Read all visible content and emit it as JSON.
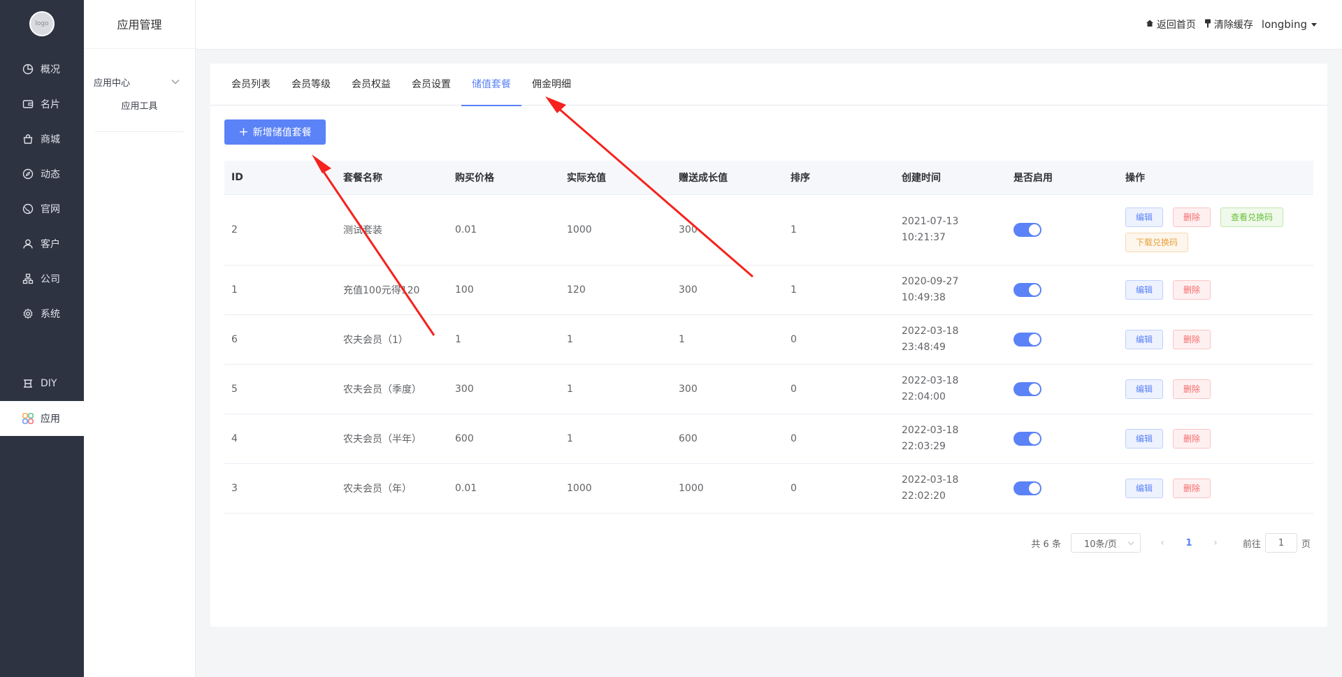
{
  "nav": {
    "logo_text": "logo",
    "items": [
      {
        "label": "概况"
      },
      {
        "label": "名片"
      },
      {
        "label": "商城"
      },
      {
        "label": "动态"
      },
      {
        "label": "官网"
      },
      {
        "label": "客户"
      },
      {
        "label": "公司"
      },
      {
        "label": "系统"
      },
      {
        "label": "DIY"
      },
      {
        "label": "应用"
      }
    ]
  },
  "submenu": {
    "title": "应用管理",
    "group_label": "应用中心",
    "item_label": "应用工具"
  },
  "header": {
    "home": "返回首页",
    "clear_cache": "清除缓存",
    "user": "longbing"
  },
  "tabs": [
    "会员列表",
    "会员等级",
    "会员权益",
    "会员设置",
    "储值套餐",
    "佣金明细"
  ],
  "active_tab": 4,
  "add_button": "新增储值套餐",
  "table": {
    "columns": [
      "ID",
      "套餐名称",
      "购买价格",
      "实际充值",
      "赠送成长值",
      "排序",
      "创建时间",
      "是否启用",
      "操作"
    ],
    "rows": [
      {
        "id": "2",
        "name": "测试套装",
        "price": "0.01",
        "recharge": "1000",
        "growth": "300",
        "sort": "1",
        "date": "2021-07-13",
        "time": "10:21:37"
      },
      {
        "id": "1",
        "name": "充值100元得120",
        "price": "100",
        "recharge": "120",
        "growth": "300",
        "sort": "1",
        "date": "2020-09-27",
        "time": "10:49:38"
      },
      {
        "id": "6",
        "name": "农夫会员（1）",
        "price": "1",
        "recharge": "1",
        "growth": "1",
        "sort": "0",
        "date": "2022-03-18",
        "time": "23:48:49"
      },
      {
        "id": "5",
        "name": "农夫会员（季度）",
        "price": "300",
        "recharge": "1",
        "growth": "300",
        "sort": "0",
        "date": "2022-03-18",
        "time": "22:04:00"
      },
      {
        "id": "4",
        "name": "农夫会员（半年）",
        "price": "600",
        "recharge": "1",
        "growth": "600",
        "sort": "0",
        "date": "2022-03-18",
        "time": "22:03:29"
      },
      {
        "id": "3",
        "name": "农夫会员（年）",
        "price": "0.01",
        "recharge": "1000",
        "growth": "1000",
        "sort": "0",
        "date": "2022-03-18",
        "time": "22:02:20"
      }
    ],
    "actions": {
      "edit": "编辑",
      "delete": "删除",
      "view_codes": "查看兑换码",
      "download_codes": "下载兑换码"
    }
  },
  "pagination": {
    "total": "共 6 条",
    "page_size": "10条/页",
    "current_page": "1",
    "goto_prefix": "前往",
    "goto_value": "1",
    "goto_suffix": "页"
  },
  "colors": {
    "primary": "#5b82f6",
    "sidebar": "#2d3341",
    "danger": "#f56c6c",
    "success": "#67c23a",
    "warning": "#e6a23c",
    "annotation_arrow": "#f5221d"
  }
}
